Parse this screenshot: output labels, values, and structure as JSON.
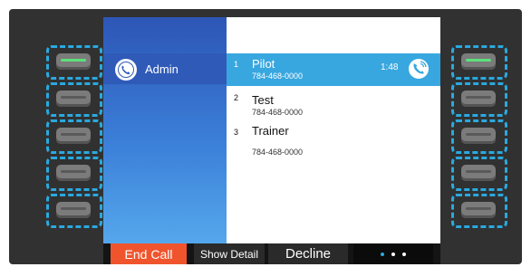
{
  "sidebar": {
    "line_label": "Admin"
  },
  "calls": [
    {
      "index": "1",
      "name": "Pilot",
      "phone": "784-468-0000",
      "timer": "1:48",
      "selected": true
    },
    {
      "index": "2",
      "name": "Test",
      "phone": "784-468-0000",
      "selected": false
    },
    {
      "index": "3",
      "name": "Trainer",
      "phone": "784-468-0000",
      "selected": false
    }
  ],
  "softkeys": {
    "end_call": "End Call",
    "show_detail": "Show Detail",
    "decline": "Decline",
    "more_icon": "more-dots-icon"
  },
  "colors": {
    "accent": "#38a7df",
    "end_call": "#f0542c",
    "led_active": "#5ce07a",
    "sidebar_top": "#2d56b6"
  },
  "icons": {
    "line": "phone-handset-icon",
    "active_call": "phone-ringing-icon"
  }
}
